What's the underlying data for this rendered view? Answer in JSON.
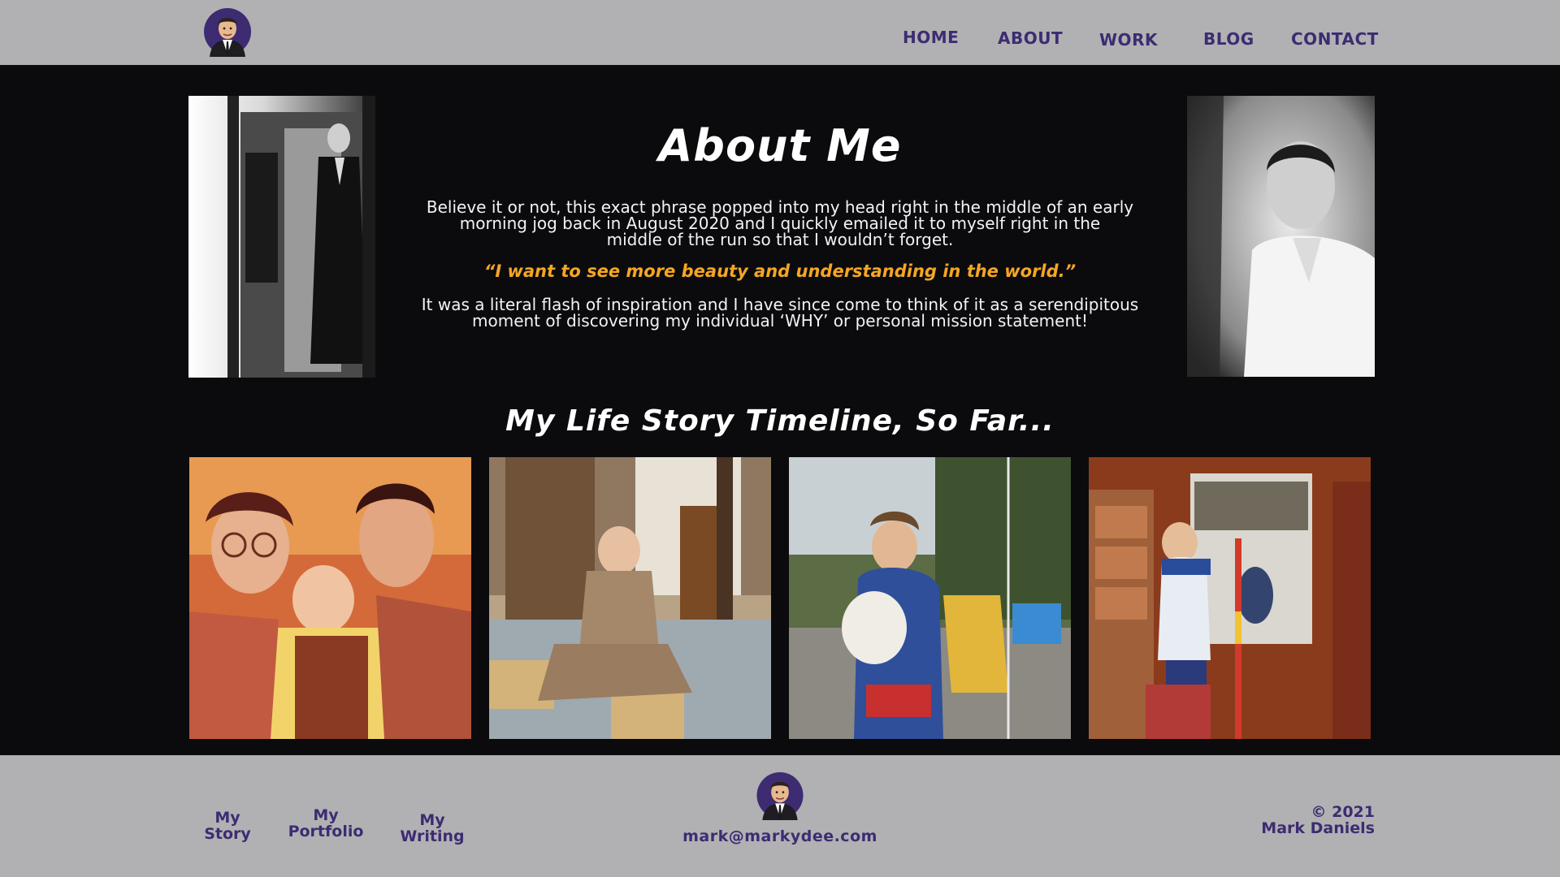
{
  "header": {
    "nav": [
      "HOME",
      "ABOUT",
      "WORK",
      "BLOG",
      "CONTACT"
    ]
  },
  "about": {
    "title": "About Me",
    "paragraph1_line1": "Believe it or not, this exact phrase popped into my head right in the middle of an early",
    "paragraph1_line2": "morning jog back in August 2020 and I quickly emailed it to myself right in the",
    "paragraph1_line3": "middle of the run so that I wouldn’t forget.",
    "quote": "“I want to see more beauty and understanding in the world.”",
    "paragraph2_line1": "It was a literal flash of inspiration and I have since come to think of it as a serendipitous",
    "paragraph2_line2": "moment of discovering my individual ‘WHY’ or personal mission statement!"
  },
  "timeline": {
    "title": "My Life Story Timeline, So Far..."
  },
  "footer": {
    "links": [
      {
        "line1": "My",
        "line2": "Story"
      },
      {
        "line1": "My",
        "line2": "Portfolio"
      },
      {
        "line1": "My",
        "line2": "Writing"
      }
    ],
    "email": "mark@markydee.com",
    "copyright": "© 2021",
    "name": "Mark Daniels"
  },
  "colors": {
    "header_bg": "#b1b1b3",
    "page_bg": "#0b0b0e",
    "nav_text": "#3d2c72",
    "quote": "#f5a623"
  },
  "icons": [
    "avatar-logo-icon"
  ]
}
